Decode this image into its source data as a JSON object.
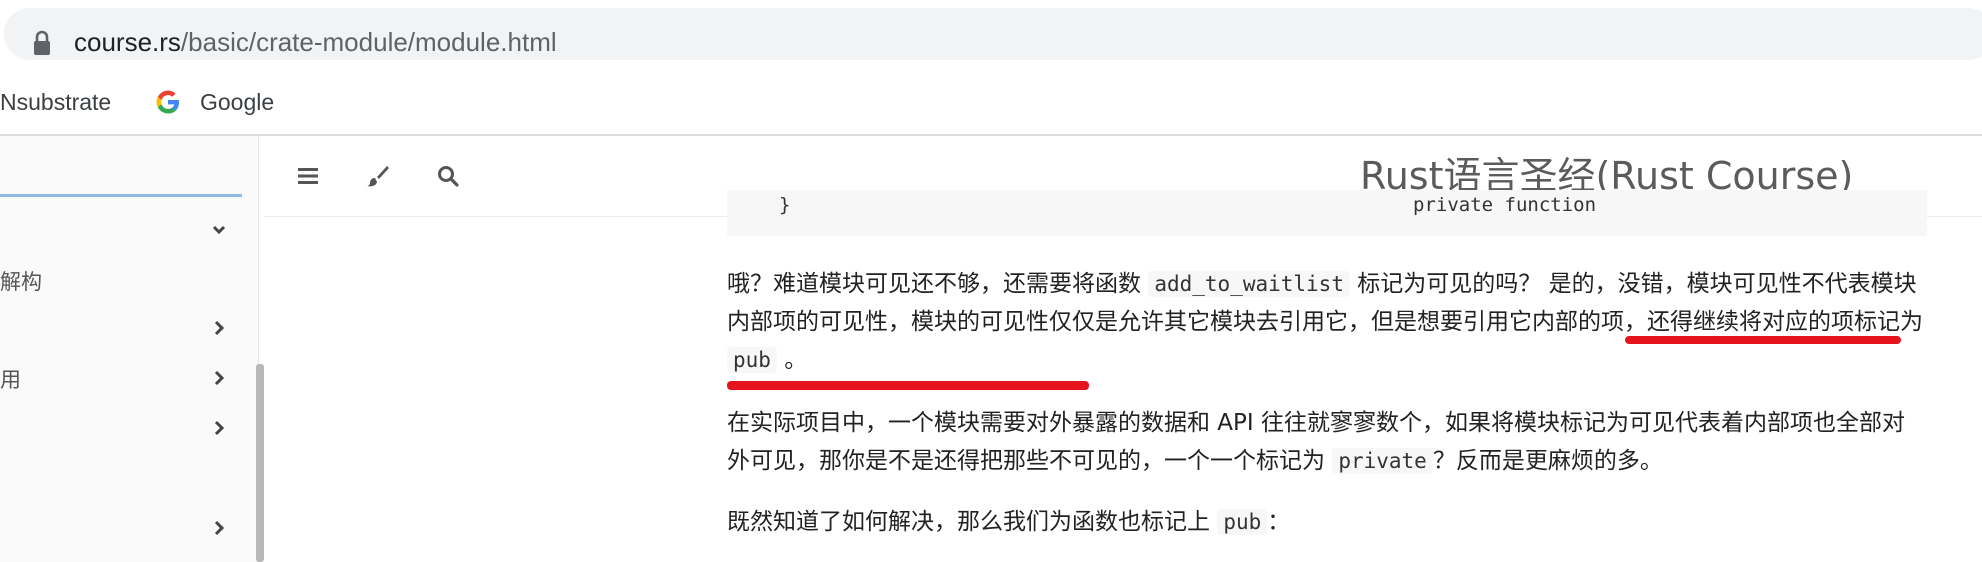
{
  "browser": {
    "url_host": "course.rs",
    "url_path": "/basic/crate-module/module.html",
    "lock_icon": "lock-icon"
  },
  "bookmarks": [
    {
      "label": "Nsubstrate"
    },
    {
      "label": "Google",
      "icon": "google-icon"
    }
  ],
  "sidebar": {
    "items": [
      {
        "label": "解构"
      },
      {
        "label": "用"
      }
    ],
    "chevron_icon": "chevron-right-icon",
    "expanded_icon": "chevron-down-icon"
  },
  "header": {
    "menu_icon": "hamburger-menu-icon",
    "theme_icon": "paintbrush-icon",
    "search_icon": "search-icon",
    "title": "Rust语言圣经(Rust Course)"
  },
  "content": {
    "code_fragment_left": "}",
    "code_fragment_right": "private function",
    "p1_a": "哦？难道模块可见还不够，还需要将函数 ",
    "p1_code": "add_to_waitlist",
    "p1_b": " 标记为可见的吗？ 是的，没错，模块可见性不代表模块内部项的可见性，模块的可见性仅仅是允许其它模块去引用它，但是",
    "p1_highlight": "想要引用它内部的项，还得继续将对应的项标记为 ",
    "p1_code2": "pub",
    "p1_c": " 。",
    "p2_a": "在实际项目中，一个模块需要对外暴露的数据和 API 往往就寥寥数个，如果将模块标记为可见代表着内部项也全部对外可见，那你是不是还得把那些不可见的，一个一个标记为 ",
    "p2_code": "private",
    "p2_b": "？反而是更麻烦的多。",
    "p3_a": "既然知道了如何解决，那么我们为函数也标记上 ",
    "p3_code": "pub",
    "p3_b": "："
  },
  "colors": {
    "annotation_red": "#e5131b",
    "search_focus": "#8fb8e9"
  }
}
